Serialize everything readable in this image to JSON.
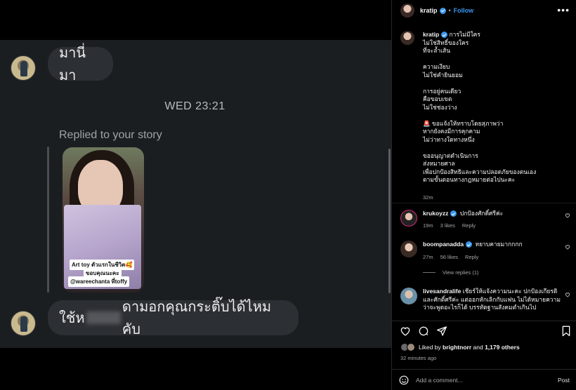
{
  "dm": {
    "message_top": "มานี่มา",
    "timestamp": "WED 23:21",
    "replied_label": "Replied to your story",
    "story_caption_line1": "Art toy ตัวแรกในชีวิต🥰",
    "story_caption_line2": "ขอบคุณนะคะ",
    "story_caption_line3": "@wareechanta  ที่toffy",
    "message_bottom_prefix": "ใช้ห",
    "message_bottom_suffix": "ดามอกคุณกระติ๊บได้ไหมคับ"
  },
  "post": {
    "username": "kratip",
    "follow_label": "Follow",
    "more_label": "•••",
    "caption_user": "kratip",
    "caption_text": "การไม่มีใคร\nไม่ใช่สิทธิ์ของใคร\nที่จะล้ำเส้น\n\nความเงียบ\nไม่ใช่คำยินยอม\n\nการอยู่คนเดียว\nคือขอบเขต\nไม่ใช่ช่องว่าง\n\n🚨 ขอแจ้งให้ทราบโดยสุภาพว่า\nหากยังคงมีการคุกคาม\nไม่ว่าทางใดทางหนึ่ง\n\nขออนุญาตดำเนินการ\nส่งหมายศาล\nเพื่อปกป้องสิทธิและความปลอดภัยของตนเอง\nตามขั้นตอนทางกฎหมายต่อไปนะคะ",
    "caption_time": "32m",
    "comments": [
      {
        "user": "krukoyzz",
        "text": "ปกป้องศักดิ์ศรีค่ะ",
        "time": "19m",
        "likes": "3 likes",
        "reply": "Reply",
        "verified": true
      },
      {
        "user": "boompanadda",
        "text": "หยาบคายมากกกก",
        "time": "27m",
        "likes": "56 likes",
        "reply": "Reply",
        "verified": true
      },
      {
        "user": "livesandralife",
        "text": "เชียร์ให้แจ้งความนะคะ ปกป้องเกียรติและศักดิ์ศรีค่ะ แต่ออกหักเลิกกับแฟน ไม่ได้หมายความว่าจะพูดอะไรก็ได้ บรรทัดฐานสังคมตำเกินไป",
        "verified": false
      }
    ],
    "view_replies": "View replies (1)",
    "liked_by_prefix": "Liked by",
    "liked_by_user": "brightnorr",
    "liked_by_and": "and",
    "liked_by_others": "1,179 others",
    "post_time": "32 minutes ago",
    "add_comment_placeholder": "Add a comment...",
    "post_button": "Post"
  },
  "colors": {
    "accent": "#3897f0",
    "dm_background": "#1b1e21",
    "bubble": "#2c2f33",
    "panel_background": "#000000"
  },
  "icons": [
    "heart-icon",
    "comment-icon",
    "share-icon",
    "bookmark-icon",
    "emoji-icon",
    "verified-icon",
    "more-icon"
  ]
}
